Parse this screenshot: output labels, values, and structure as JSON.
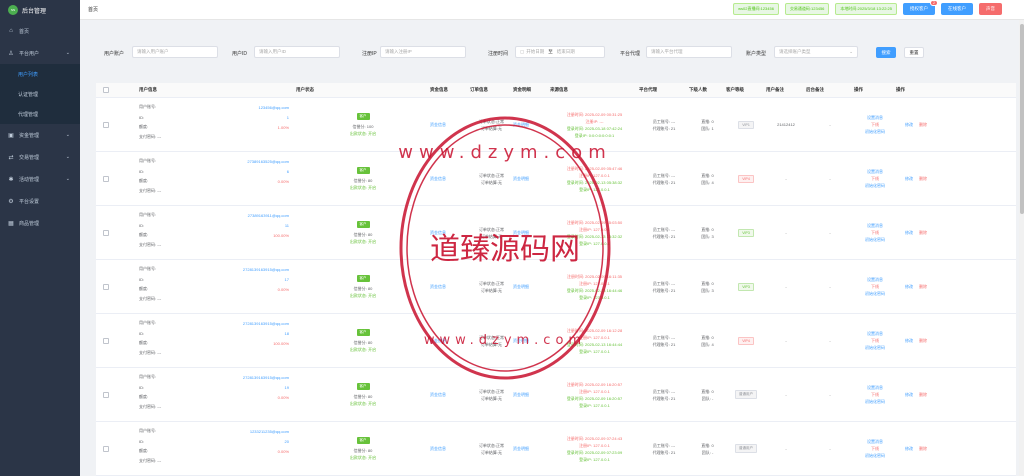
{
  "app": {
    "title": "后台管理",
    "logo_text": "NN"
  },
  "sidebar": {
    "items": [
      {
        "label": "首页",
        "icon": "home-icon"
      },
      {
        "label": "平台用户",
        "icon": "user-icon",
        "expanded": true,
        "children": [
          {
            "label": "用户列表",
            "active": true
          },
          {
            "label": "认证管理"
          },
          {
            "label": "代理管理"
          }
        ]
      },
      {
        "label": "资金管理",
        "icon": "wallet-icon"
      },
      {
        "label": "交易管理",
        "icon": "trade-icon"
      },
      {
        "label": "活动管理",
        "icon": "gift-icon"
      },
      {
        "label": "平台设置",
        "icon": "gear-icon"
      },
      {
        "label": "商品管理",
        "icon": "box-icon"
      }
    ]
  },
  "topbar": {
    "breadcrumb": "首页",
    "tag1": "ws02直播间:123456",
    "tag2": "交易通道码:123456",
    "tag3": "本地时间:2025/3/18 13:22:25",
    "btn_customer": "授权客户",
    "btn_customer_badge": "2",
    "btn_online": "在线客户",
    "btn_sound": "声音"
  },
  "filters": {
    "account_label": "用户账户",
    "account_placeholder": "请输入用户账户",
    "id_label": "用户ID",
    "id_placeholder": "请输入用户ID",
    "ip_label": "注册IP",
    "ip_placeholder": "请输入注册IP",
    "time_label": "注册时间",
    "time_start": "开始日期",
    "time_sep": "至",
    "time_end": "结束日期",
    "agent_label": "平台代理",
    "agent_placeholder": "请输入平台代理",
    "type_label": "账户类型",
    "type_placeholder": "请选择账户类型",
    "search_btn": "搜索",
    "reset_btn": "重置"
  },
  "table": {
    "headers": [
      "用户信息",
      "用户状态",
      "资金信息",
      "订单信息",
      "资金明细",
      "来源信息",
      "平台代理",
      "下级人数",
      "客户等级",
      "用户备注",
      "后台备注",
      "操作",
      "操作"
    ],
    "rows": [
      {
        "acct": "123456@qq.com",
        "id": "1",
        "bal": "1.00%",
        "tag": "客户",
        "credit": "信誉分: 100",
        "login": "出款状态: 开启",
        "order1": "订单状态:正常",
        "order2": "订单结算:无",
        "reg": "注册时间: 2025-02-09 00:31:25",
        "regip": "注册IP: ---",
        "login_time": "登录时间: 2025-03-18 07:42:24",
        "loginip": "登录IP: 0:0:0:0:0:0:0:1",
        "agent1": "员工账号: ---",
        "agent2": "代理账号: 21",
        "down1": "直推: 0",
        "down2": "团队: 1",
        "level": "VIP1",
        "level_style": "gray",
        "remark": "21412412",
        "back": "-"
      },
      {
        "acct": "27389163525@qq.com",
        "id": "6",
        "bal": "0.00%",
        "tag": "客户",
        "credit": "信誉分: 80",
        "login": "出款状态: 开启",
        "order1": "订单状态:正常",
        "order2": "订单结算:无",
        "reg": "注册时间: 2025-02-09 05:47:46",
        "regip": "注册IP: 127.0.0.1",
        "login_time": "登录时间: 2025-02-13 05:38:32",
        "loginip": "登录IP: 127.0.0.1",
        "agent1": "员工账号: ---",
        "agent2": "代理账号: 21",
        "down1": "直推: 0",
        "down2": "团队: 4",
        "level": "VIP4",
        "level_style": "red",
        "remark": "-",
        "back": "-"
      },
      {
        "acct": "27389163911@qq.com",
        "id": "11",
        "bal": "100.00%",
        "tag": "客户",
        "credit": "信誉分: 80",
        "login": "出款状态: 开启",
        "order1": "订单状态:正常",
        "order2": "订单结算:无",
        "reg": "注册时间: 2025-02-09 15:03:50",
        "regip": "注册IP: 127.0.0.1",
        "login_time": "登录时间: 2025-02-13 13:32:32",
        "loginip": "登录IP: 127.0.0.1",
        "agent1": "员工账号: ---",
        "agent2": "代理账号: 21",
        "down1": "直推: 0",
        "down2": "团队: 3",
        "level": "VIP3",
        "level_style": "green",
        "remark": "-",
        "back": "-"
      },
      {
        "acct": "2728139163915@qq.com",
        "id": "17",
        "bal": "0.00%",
        "tag": "客户",
        "credit": "信誉分: 80",
        "login": "出款状态: 开启",
        "order1": "订单状态:正常",
        "order2": "订单结算:无",
        "reg": "注册时间: 2025-02-09 16:11:35",
        "regip": "注册IP: 127.0.0.1",
        "login_time": "登录时间: 2025-02-13 16:44:46",
        "loginip": "登录IP: 127.0.0.1",
        "agent1": "员工账号: ---",
        "agent2": "代理账号: 21",
        "down1": "直推: 0",
        "down2": "团队: 3",
        "level": "VIP3",
        "level_style": "green",
        "remark": "-",
        "back": "-"
      },
      {
        "acct": "2728139163915@qq.com",
        "id": "18",
        "bal": "100.00%",
        "tag": "客户",
        "credit": "信誉分: 80",
        "login": "出款状态: 开启",
        "order1": "订单状态:正常",
        "order2": "订单结算:无",
        "reg": "注册时间: 2025-02-09 16:12:28",
        "regip": "注册IP: 127.0.0.1",
        "login_time": "登录时间: 2025-02-13 16:44:44",
        "loginip": "登录IP: 127.0.0.1",
        "agent1": "员工账号: ---",
        "agent2": "代理账号: 21",
        "down1": "直推: 0",
        "down2": "团队: 4",
        "level": "VIP4",
        "level_style": "red",
        "remark": "-",
        "back": "-"
      },
      {
        "acct": "2728139163915@qq.com",
        "id": "19",
        "bal": "0.00%",
        "tag": "客户",
        "credit": "信誉分: 80",
        "login": "出款状态: 开启",
        "order1": "订单状态:正常",
        "order2": "订单结算:无",
        "reg": "注册时间: 2025-02-09 16:20:57",
        "regip": "注册IP: 127.0.0.1",
        "login_time": "登录时间: 2025-02-09 16:20:57",
        "loginip": "登录IP: 127.0.0.1",
        "agent1": "员工账号: ---",
        "agent2": "代理账号: 21",
        "down1": "直推: 0",
        "down2": "团队: -",
        "level": "普通用户",
        "level_style": "gray",
        "remark": "-",
        "back": "-"
      },
      {
        "acct": "1233211235@qq.com",
        "id": "20",
        "bal": "0.00%",
        "tag": "客户",
        "credit": "信誉分: 80",
        "login": "出款状态: 开启",
        "order1": "订单状态:正常",
        "order2": "订单结算:无",
        "reg": "注册时间: 2025-02-09 07:24:43",
        "regip": "注册IP: 127.0.0.1",
        "login_time": "登录时间: 2025-02-09 07:23:09",
        "loginip": "登录IP: 127.0.0.1",
        "agent1": "员工账号: ---",
        "agent2": "代理账号: 21",
        "down1": "直推: 0",
        "down2": "团队: -",
        "level": "普通用户",
        "level_style": "gray",
        "remark": "-",
        "back": "-"
      }
    ],
    "u_labels": {
      "acct": "用户账号:",
      "id": "ID:",
      "bal": "额度:",
      "pay": "支付密码: ---"
    },
    "fund_link": "资金信息",
    "flow_link": "资金明细",
    "op1": [
      "设置消息",
      "下线",
      "初始化密码"
    ],
    "op2": [
      "修改",
      "删除"
    ]
  },
  "watermark": {
    "main": "道臻源码网",
    "url": "www.dzym.com"
  }
}
